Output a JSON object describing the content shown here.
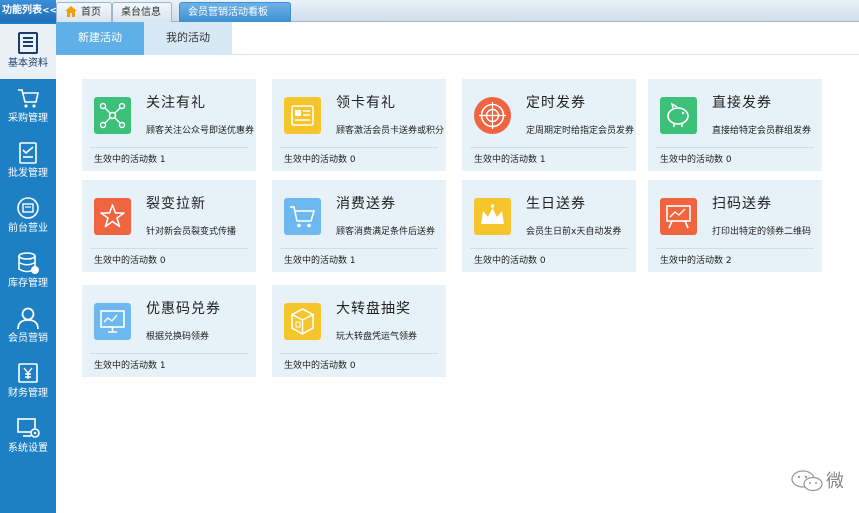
{
  "topbar": {
    "func_list": "功能列表",
    "collapse_arrows": "<<",
    "tabs": [
      {
        "label": "首页"
      },
      {
        "label": "桌台信息"
      },
      {
        "label": "会员营销活动看板"
      }
    ]
  },
  "sidebar": {
    "items": [
      {
        "label": "基本资料",
        "icon": "book-icon"
      },
      {
        "label": "采购管理",
        "icon": "cart-icon"
      },
      {
        "label": "批发管理",
        "icon": "checklist-icon"
      },
      {
        "label": "前台营业",
        "icon": "pos-icon"
      },
      {
        "label": "库存管理",
        "icon": "database-icon"
      },
      {
        "label": "会员营销",
        "icon": "user-icon"
      },
      {
        "label": "财务管理",
        "icon": "money-icon"
      },
      {
        "label": "系统设置",
        "icon": "settings-icon"
      }
    ]
  },
  "subtabs": {
    "new_activity": "新建活动",
    "my_activity": "我的活动"
  },
  "cards": [
    {
      "title": "关注有礼",
      "desc": "顾客关注公众号即送优惠券",
      "count_label": "生效中的活动数",
      "count": "1",
      "icon": "share-network-icon",
      "color": "#3cc07a"
    },
    {
      "title": "领卡有礼",
      "desc": "顾客激活会员卡送券或积分",
      "count_label": "生效中的活动数",
      "count": "0",
      "icon": "card-icon",
      "color": "#f5c52b"
    },
    {
      "title": "定时发券",
      "desc": "定周期定时给指定会员发券",
      "count_label": "生效中的活动数",
      "count": "1",
      "icon": "target-icon",
      "color": "#f0643f"
    },
    {
      "title": "直接发券",
      "desc": "直接给特定会员群组发券",
      "count_label": "生效中的活动数",
      "count": "0",
      "icon": "piggy-bank-icon",
      "color": "#3cc07a"
    },
    {
      "title": "裂变拉新",
      "desc": "针对新会员裂变式传播",
      "count_label": "生效中的活动数",
      "count": "0",
      "icon": "star-icon",
      "color": "#f0643f"
    },
    {
      "title": "消费送券",
      "desc": "顾客消费满足条件后送券",
      "count_label": "生效中的活动数",
      "count": "1",
      "icon": "shopping-cart-icon",
      "color": "#6db8f0"
    },
    {
      "title": "生日送券",
      "desc": "会员生日前x天自动发券",
      "count_label": "生效中的活动数",
      "count": "0",
      "icon": "crown-icon",
      "color": "#f5c52b"
    },
    {
      "title": "扫码送券",
      "desc": "打印出特定的领券二维码",
      "count_label": "生效中的活动数",
      "count": "2",
      "icon": "easel-icon",
      "color": "#f0643f"
    },
    {
      "title": "优惠码兑券",
      "desc": "根据兑换码领券",
      "count_label": "生效中的活动数",
      "count": "1",
      "icon": "monitor-icon",
      "color": "#6db8f0"
    },
    {
      "title": "大转盘抽奖",
      "desc": "玩大转盘凭运气领券",
      "count_label": "生效中的活动数",
      "count": "0",
      "icon": "cube-icon",
      "color": "#f5c52b"
    }
  ],
  "watermark": {
    "text": "微"
  }
}
